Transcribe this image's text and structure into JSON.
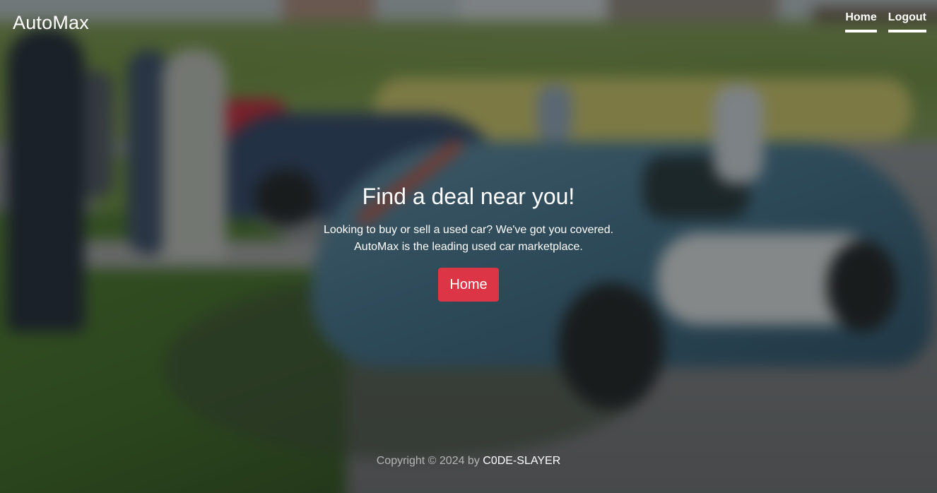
{
  "navbar": {
    "brand": "AutoMax",
    "links": [
      {
        "label": "Home"
      },
      {
        "label": "Logout"
      }
    ]
  },
  "hero": {
    "background_description_icon": "car-photo-background",
    "headline": "Find a deal near you!",
    "lead_line1": "Looking to buy or sell a used car? We've got you covered.",
    "lead_line2": "AutoMax is the leading used car marketplace.",
    "cta_label": "Home"
  },
  "footer": {
    "copyright_prefix": "Copyright © 2024 by",
    "author": "C0DE-SLAYER"
  },
  "colors": {
    "cta": "#dc3545",
    "text": "#ffffff",
    "footer_muted": "rgba(255,255,255,0.6)"
  }
}
